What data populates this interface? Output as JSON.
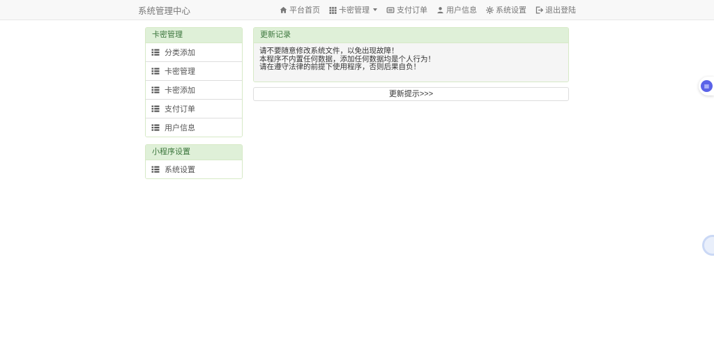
{
  "navbar": {
    "brand": "系统管理中心",
    "items": [
      {
        "label": "平台首页",
        "icon": "home-icon"
      },
      {
        "label": "卡密管理",
        "icon": "th-grid-icon",
        "has_caret": true
      },
      {
        "label": "支付订单",
        "icon": "list-alt-icon"
      },
      {
        "label": "用户信息",
        "icon": "user-icon"
      },
      {
        "label": "系统设置",
        "icon": "gear-icon"
      },
      {
        "label": "退出登陆",
        "icon": "sign-out-icon"
      }
    ]
  },
  "sidebar": {
    "panels": [
      {
        "title": "卡密管理",
        "items": [
          "分类添加",
          "卡密管理",
          "卡密添加",
          "支付订单",
          "用户信息"
        ]
      },
      {
        "title": "小程序设置",
        "items": [
          "系统设置"
        ]
      }
    ]
  },
  "main": {
    "panel_title": "更新记录",
    "notice_lines": [
      "请不要随意修改系统文件，以免出现故障！",
      "本程序不内置任何数据，添加任何数据均是个人行为！",
      "请在遵守法律的前提下使用程序，否则后果自负！"
    ],
    "update_button": "更新提示>>>"
  },
  "colors": {
    "success_bg": "#dff0d8",
    "success_text": "#3c763d",
    "success_border": "#d6e9c6",
    "navbar_bg": "#f8f8f8",
    "nav_text": "#777777",
    "float_widget_accent": "#5b63e8"
  }
}
